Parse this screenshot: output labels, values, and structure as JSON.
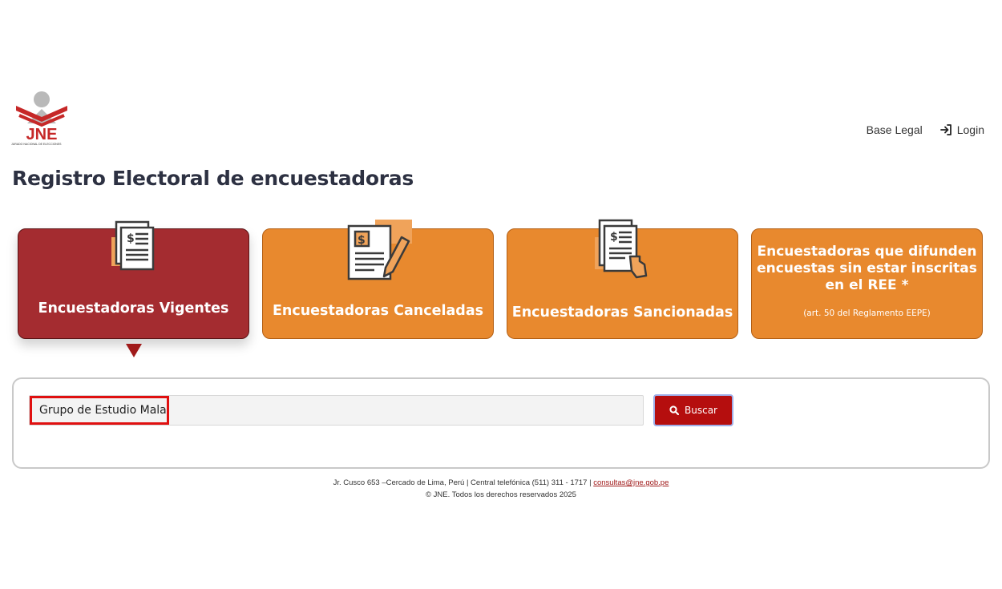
{
  "header": {
    "logo_text": "JNE",
    "logo_caption": "JURADO NACIONAL DE ELECCIONES",
    "nav": {
      "base_legal": "Base Legal",
      "login": "Login"
    }
  },
  "page": {
    "title": "Registro Electoral de encuestadoras"
  },
  "cards": [
    {
      "label": "Encuestadoras Vigentes",
      "active": true
    },
    {
      "label": "Encuestadoras Canceladas"
    },
    {
      "label": "Encuestadoras Sancionadas"
    },
    {
      "title": "Encuestadoras que difunden encuestas sin estar inscritas en el REE *",
      "subtitle": "(art. 50 del Reglamento EEPE)"
    }
  ],
  "search": {
    "value": "Grupo de Estudio Mala",
    "button_label": "Buscar"
  },
  "footer": {
    "address": "Jr. Cusco 653 –Cercado de Lima, Perú | Central telefónica (511) 311 - 1717 |",
    "email": "consultas@jne.gob.pe",
    "copyright": "© JNE. Todos los derechos reservados 2025"
  },
  "colors": {
    "orange": "#e8892e",
    "active_card": "#a42c30",
    "accent_red": "#b50e0e",
    "title": "#2d3142"
  },
  "icons": [
    "jne-logo-icon",
    "login-icon",
    "invoice-icon",
    "document-pencil-icon",
    "document-hand-icon",
    "search-icon"
  ]
}
